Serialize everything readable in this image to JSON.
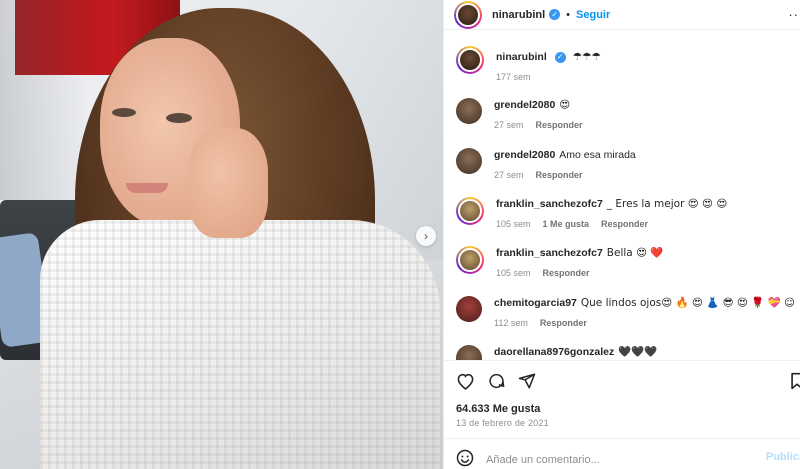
{
  "post": {
    "carousel_next_icon": "chevron-right-icon"
  },
  "header": {
    "username": "ninarubinl",
    "verified": true,
    "separator": "•",
    "follow_label": "Seguir",
    "more_icon": "more-icon",
    "more_label": "··"
  },
  "caption": {
    "username": "ninarubinl",
    "text": "☂☂☂",
    "time": "177 sem"
  },
  "comments": [
    {
      "username": "grendel2080",
      "text": "😍",
      "time": "27 sem",
      "likes": "",
      "reply": "Responder"
    },
    {
      "username": "grendel2080",
      "text": "Amo esa mirada",
      "time": "27 sem",
      "likes": "",
      "reply": "Responder"
    },
    {
      "username": "franklin_sanchezofc7",
      "text": "_ Eres la mejor 😍 😍 😍",
      "time": "105 sem",
      "likes": "1 Me gusta",
      "reply": "Responder"
    },
    {
      "username": "franklin_sanchezofc7",
      "text": "Bella 😍 ❤️",
      "time": "105 sem",
      "likes": "",
      "reply": "Responder"
    },
    {
      "username": "chemitogarcia97",
      "text": "Que lindos ojos😍 🔥 😍 👗 😎 😍 🌹 💝 ☺",
      "time": "112 sem",
      "likes": "",
      "reply": "Responder"
    },
    {
      "username": "daorellana8976gonzalez",
      "text": "🖤🖤🖤",
      "time": "",
      "likes": "",
      "reply": ""
    }
  ],
  "actions": {
    "like_icon": "heart-icon",
    "comment_icon": "comment-icon",
    "share_icon": "share-icon",
    "save_icon": "bookmark-icon"
  },
  "likes_count": "64.633 Me gusta",
  "date": "13 de febrero de 2021",
  "composer": {
    "emoji_icon": "emoji-icon",
    "placeholder": "Añade un comentario...",
    "publish_label": "Publica"
  },
  "colors": {
    "link": "#0095f6",
    "verified": "#3897f0",
    "muted": "#8e8e8e",
    "publish_disabled": "#b2dffc"
  }
}
